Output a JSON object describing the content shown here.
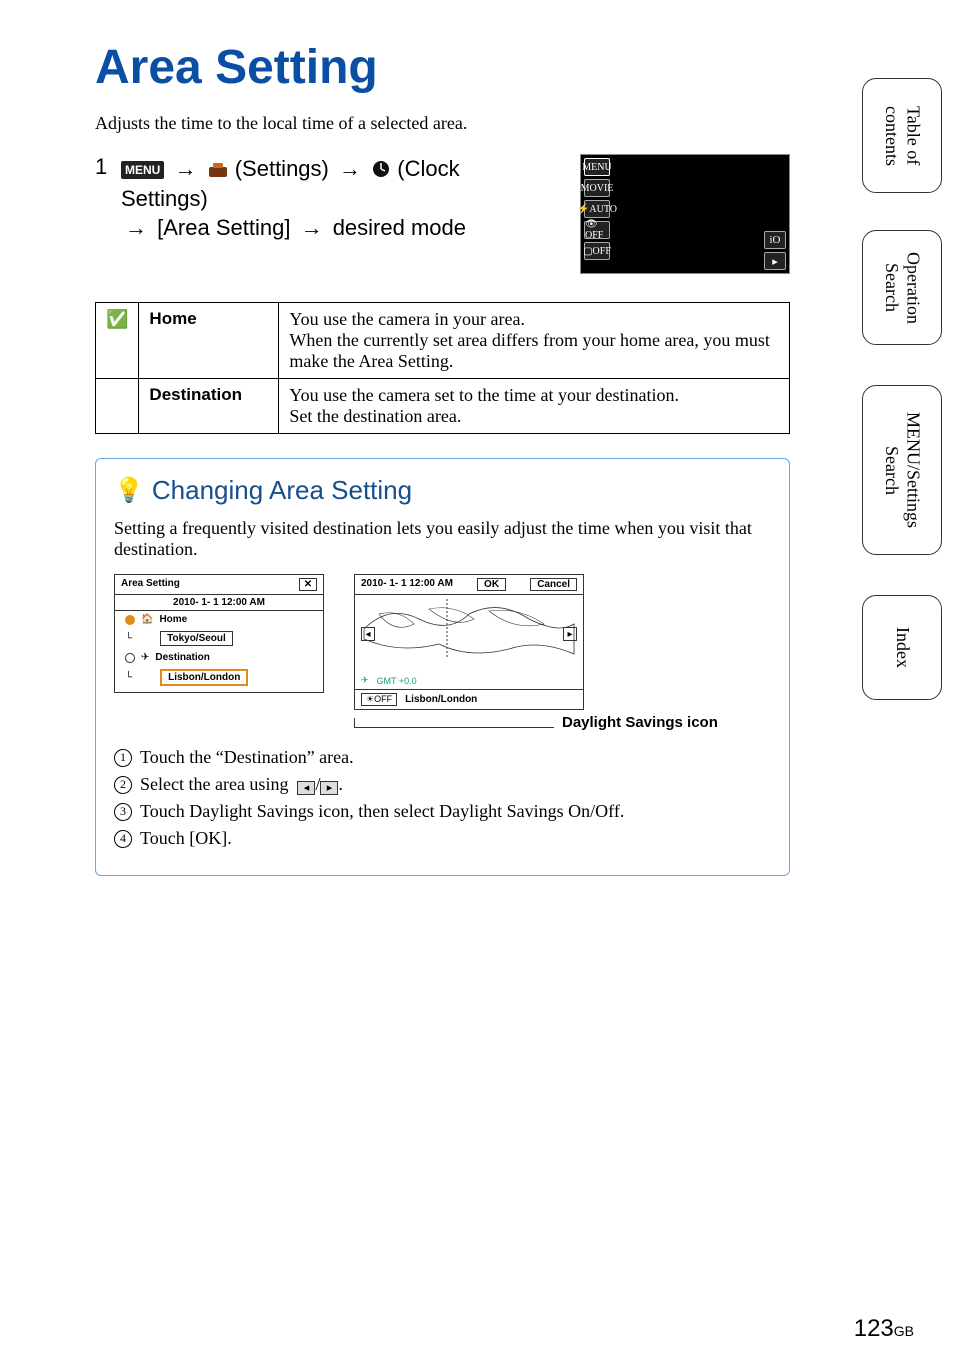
{
  "title": "Area Setting",
  "intro": "Adjusts the time to the local time of a selected area.",
  "step": {
    "num": "1",
    "menu_badge": "MENU",
    "settings_label": "(Settings)",
    "clock_label": "(Clock Settings)",
    "area_setting_label": "[Area Setting]",
    "desired_mode_label": "desired mode"
  },
  "camera_preview": {
    "left_icons": [
      "MENU",
      "MOVIE",
      "⚡AUTO",
      "👁OFF",
      "▢OFF"
    ],
    "right_icons": [
      "iO",
      "▸"
    ]
  },
  "table": {
    "rows": [
      {
        "checked": true,
        "name": "Home",
        "desc": "You use the camera in your area.\nWhen the currently set area differs from your home area, you must make the Area Setting."
      },
      {
        "checked": false,
        "name": "Destination",
        "desc": "You use the camera set to the time at your destination.\nSet the destination area."
      }
    ]
  },
  "tip": {
    "title": "Changing Area Setting",
    "para": "Setting a frequently visited destination lets you easily adjust the time when you visit that destination.",
    "screen1": {
      "header": "Area Setting",
      "close": "✕",
      "date": "2010- 1- 1  12:00 AM",
      "home_label": "Home",
      "home_city": "Tokyo/Seoul",
      "dest_label": "Destination",
      "dest_city": "Lisbon/London"
    },
    "screen2": {
      "date": "2010- 1- 1  12:00 AM",
      "ok": "OK",
      "cancel": "Cancel",
      "nav_left": "◂",
      "nav_right": "▸",
      "gmt": "GMT  +0.0",
      "ds_icon": "☀OFF",
      "city": "Lisbon/London"
    },
    "ds_label": "Daylight Savings icon",
    "steps": [
      "Touch the “Destination” area.",
      "Select the area using",
      "Touch Daylight Savings icon, then select Daylight Savings On/Off.",
      "Touch [OK]."
    ],
    "step2_suffix": "."
  },
  "side_tabs": {
    "t1": "Table of contents",
    "t2": "Operation Search",
    "t3": "MENU/Settings Search",
    "t4": "Index"
  },
  "page_number": "123",
  "page_suffix": "GB"
}
